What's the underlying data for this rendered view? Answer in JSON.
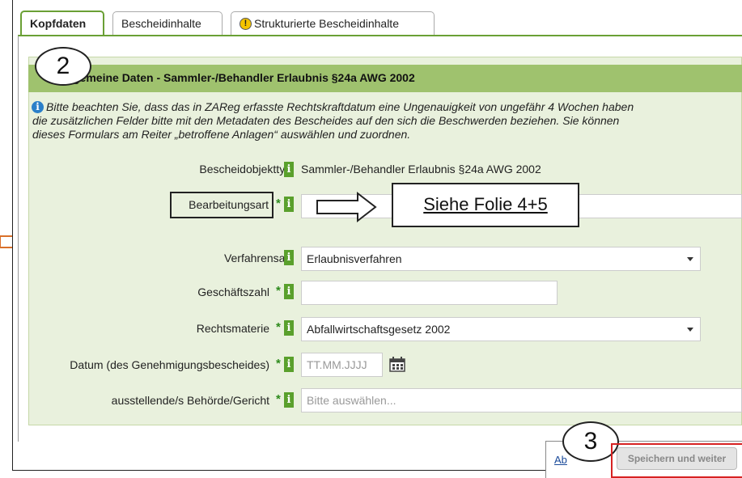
{
  "tabs": [
    {
      "label": "Kopfdaten",
      "active": true
    },
    {
      "label": "Bescheidinhalte",
      "active": false
    },
    {
      "label": "Strukturierte Bescheidinhalte",
      "active": false,
      "icon": "warning-icon"
    }
  ],
  "section": {
    "title": "Allgemeine Daten - Sammler-/Behandler Erlaubnis §24a AWG 2002",
    "title_visible": "gemeine Daten - Sammler-/Behandler Erlaubnis §24a AWG 2002"
  },
  "info": {
    "icon": "info-icon",
    "line1": "Bitte beachten Sie, dass das in ZAReg erfasste Rechtskraftdatum eine Ungenauigkeit von ungefähr 4 Wochen haben",
    "line2": "die zusätzlichen Felder bitte mit den Metadaten des Bescheides auf den sich die Beschwerden beziehen. Sie können",
    "line3": "dieses Formulars am Reiter „betroffene Anlagen“ auswählen und zuordnen."
  },
  "form": {
    "bescheidobjekttyp": {
      "label": "Bescheidobjekttyp",
      "value": "Sammler-/Behandler Erlaubnis §24a AWG 2002"
    },
    "bearbeitungsart": {
      "label": "Bearbeitungsart",
      "required": "*",
      "value": ""
    },
    "verfahrensart": {
      "label": "Verfahrensart",
      "value": "Erlaubnisverfahren"
    },
    "geschaeftszahl": {
      "label": "Geschäftszahl",
      "required": "*",
      "value": ""
    },
    "rechtsmaterie": {
      "label": "Rechtsmaterie",
      "required": "*",
      "value": "Abfallwirtschaftsgesetz 2002"
    },
    "datum": {
      "label": "Datum (des Genehmigungsbescheides)",
      "required": "*",
      "placeholder": "TT.MM.JJJJ"
    },
    "behoerde": {
      "label": "ausstellende/s Behörde/Gericht",
      "required": "*",
      "placeholder": "Bitte auswählen..."
    }
  },
  "info_badge": "i",
  "annotations": {
    "callout_2": "2",
    "callout_3": "3",
    "folie": "Siehe Folie 4+5"
  },
  "footer": {
    "abbrechen": "Ab",
    "save_label": "Speichern und weiter"
  },
  "colors": {
    "tab_accent": "#6aa035",
    "section_header": "#9fc26e",
    "form_background": "#e9f1dd",
    "info_badge": "#5aa02c",
    "highlight_red": "#d72222"
  }
}
